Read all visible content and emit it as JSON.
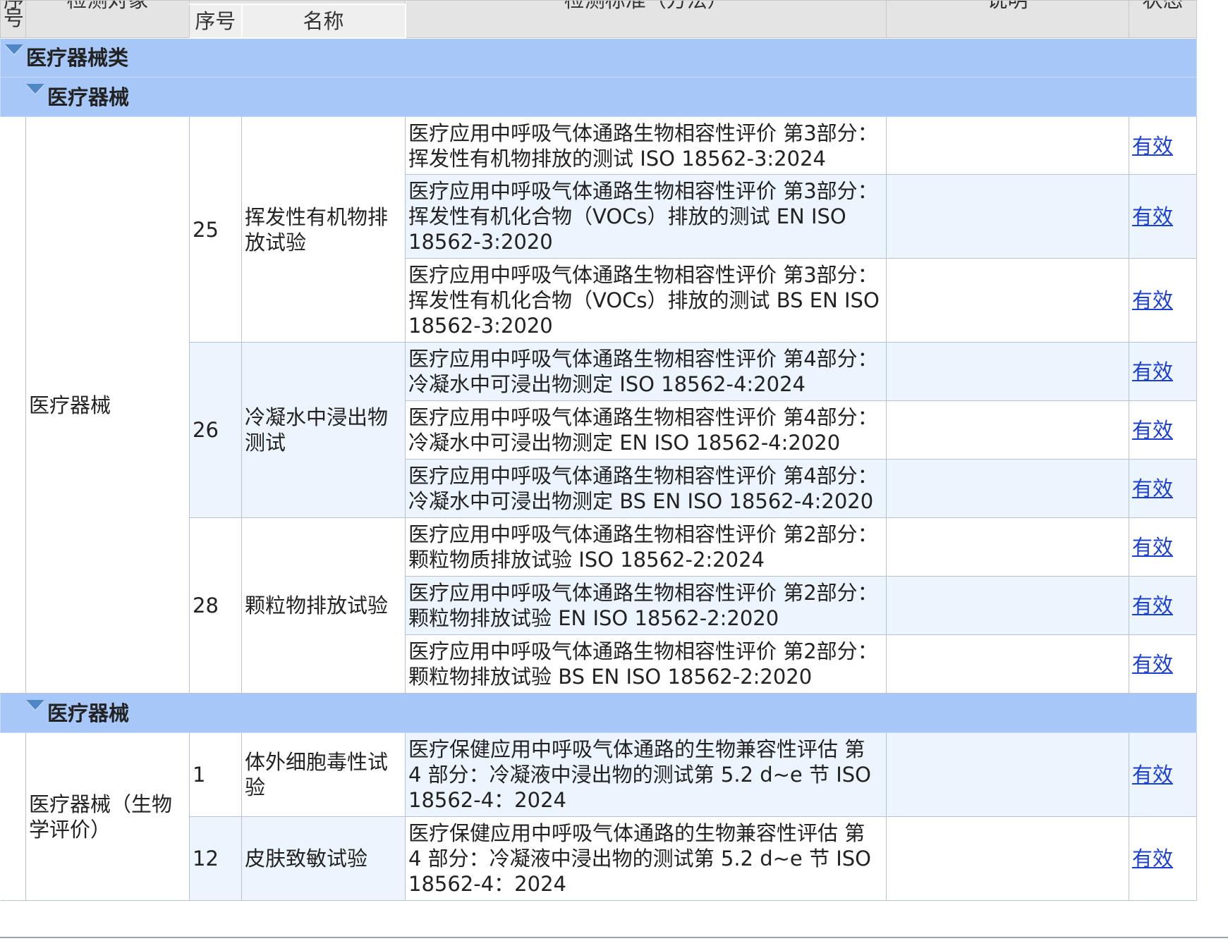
{
  "header": {
    "col_index": "序号",
    "col_object": "检测对象",
    "col_sub_no": "序号",
    "col_sub_name": "名称",
    "col_standard": "检测标准（方法）",
    "col_note": "说明",
    "col_status": "状态"
  },
  "groups": {
    "top": "医疗器械类",
    "sub1": "医疗器械",
    "sub2": "医疗器械"
  },
  "section1": {
    "object": "医疗器械",
    "items": [
      {
        "no": "25",
        "name": "挥发性有机物排放试验",
        "standards": [
          {
            "text": "医疗应用中呼吸气体通路生物相容性评价 第3部分：挥发性有机物排放的测试 ISO 18562-3:2024",
            "status": "有效"
          },
          {
            "text": "医疗应用中呼吸气体通路生物相容性评价 第3部分：挥发性有机化合物（VOCs）排放的测试 EN ISO 18562-3:2020",
            "status": "有效"
          },
          {
            "text": "医疗应用中呼吸气体通路生物相容性评价 第3部分：挥发性有机化合物（VOCs）排放的测试 BS EN ISO 18562-3:2020",
            "status": "有效"
          }
        ]
      },
      {
        "no": "26",
        "name": "冷凝水中浸出物测试",
        "standards": [
          {
            "text": "医疗应用中呼吸气体通路生物相容性评价 第4部分：冷凝水中可浸出物测定 ISO 18562-4:2024",
            "status": "有效"
          },
          {
            "text": "医疗应用中呼吸气体通路生物相容性评价 第4部分：冷凝水中可浸出物测定 EN ISO 18562-4:2020",
            "status": "有效"
          },
          {
            "text": "医疗应用中呼吸气体通路生物相容性评价 第4部分：冷凝水中可浸出物测定 BS EN ISO 18562-4:2020",
            "status": "有效"
          }
        ]
      },
      {
        "no": "28",
        "name": "颗粒物排放试验",
        "standards": [
          {
            "text": "医疗应用中呼吸气体通路生物相容性评价 第2部分：颗粒物质排放试验 ISO 18562-2:2024",
            "status": "有效"
          },
          {
            "text": "医疗应用中呼吸气体通路生物相容性评价 第2部分：颗粒物排放试验 EN ISO 18562-2:2020",
            "status": "有效"
          },
          {
            "text": "医疗应用中呼吸气体通路生物相容性评价 第2部分：颗粒物排放试验 BS EN ISO 18562-2:2020",
            "status": "有效"
          }
        ]
      }
    ]
  },
  "section2": {
    "object": "医疗器械（生物学评价）",
    "items": [
      {
        "no": "1",
        "name": "体外细胞毒性试验",
        "standards": [
          {
            "text": "医疗保健应用中呼吸气体通路的生物兼容性评估 第 4 部分：冷凝液中浸出物的测试第 5.2 d~e 节 ISO 18562-4：2024",
            "status": "有效"
          }
        ]
      },
      {
        "no": "12",
        "name": "皮肤致敏试验",
        "standards": [
          {
            "text": "医疗保健应用中呼吸气体通路的生物兼容性评估 第 4 部分：冷凝液中浸出物的测试第 5.2 d~e 节 ISO 18562-4：2024",
            "status": "有效"
          }
        ]
      }
    ]
  },
  "icons": {
    "expand": "collapse-triangle-icon"
  },
  "colors": {
    "group_bg": "#a6c7f7",
    "alt_row_bg": "#ecf4fd",
    "link": "#1b3fd0",
    "header_bg": "#e4e4e4"
  }
}
